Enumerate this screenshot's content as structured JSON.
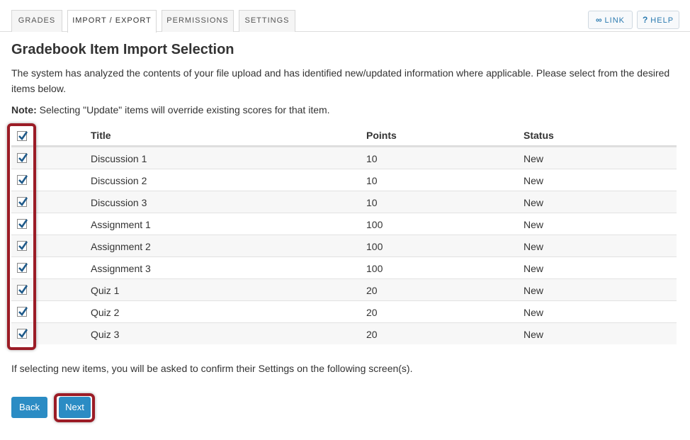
{
  "tabs": [
    {
      "label": "GRADES"
    },
    {
      "label": "IMPORT / EXPORT"
    },
    {
      "label": "PERMISSIONS"
    },
    {
      "label": "SETTINGS"
    }
  ],
  "toolbar": {
    "link_label": "LINK",
    "help_label": "HELP",
    "link_icon": "link-icon",
    "help_icon": "question-icon"
  },
  "page": {
    "title": "Gradebook Item Import Selection",
    "intro": "The system has analyzed the contents of your file upload and has identified new/updated information where applicable. Please select from the desired items below.",
    "note_label": "Note:",
    "note_text": " Selecting \"Update\" items will override existing scores for that item.",
    "footnote": "If selecting new items, you will be asked to confirm their Settings on the following screen(s)."
  },
  "table": {
    "headers": {
      "title": "Title",
      "points": "Points",
      "status": "Status"
    },
    "select_all_checked": true,
    "rows": [
      {
        "title": "Discussion 1",
        "points": "10",
        "status": "New",
        "checked": true
      },
      {
        "title": "Discussion 2",
        "points": "10",
        "status": "New",
        "checked": true
      },
      {
        "title": "Discussion 3",
        "points": "10",
        "status": "New",
        "checked": true
      },
      {
        "title": "Assignment 1",
        "points": "100",
        "status": "New",
        "checked": true
      },
      {
        "title": "Assignment 2",
        "points": "100",
        "status": "New",
        "checked": true
      },
      {
        "title": "Assignment 3",
        "points": "100",
        "status": "New",
        "checked": true
      },
      {
        "title": "Quiz 1",
        "points": "20",
        "status": "New",
        "checked": true
      },
      {
        "title": "Quiz 2",
        "points": "20",
        "status": "New",
        "checked": true
      },
      {
        "title": "Quiz 3",
        "points": "20",
        "status": "New",
        "checked": true
      }
    ]
  },
  "actions": {
    "back_label": "Back",
    "next_label": "Next"
  },
  "colors": {
    "primary_button": "#2b8cc4",
    "highlight": "#9b1c26",
    "link": "#2a7ab0"
  }
}
